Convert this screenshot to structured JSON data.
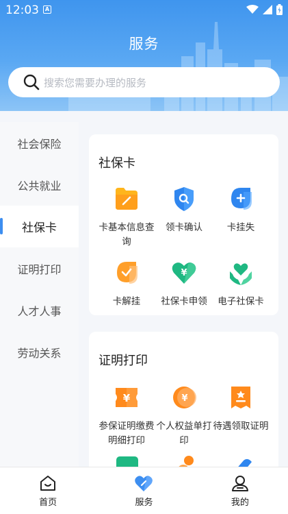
{
  "status": {
    "time": "12:03",
    "indicator": "A"
  },
  "header": {
    "title": "服务",
    "search_placeholder": "搜索您需要办理的服务"
  },
  "sidebar": {
    "items": [
      {
        "label": "社会保险",
        "active": false
      },
      {
        "label": "公共就业",
        "active": false
      },
      {
        "label": "社保卡",
        "active": true
      },
      {
        "label": "证明打印",
        "active": false
      },
      {
        "label": "人才人事",
        "active": false
      },
      {
        "label": "劳动关系",
        "active": false
      }
    ]
  },
  "sections": [
    {
      "title": "社保卡",
      "services": [
        {
          "label": "卡基本信息查询",
          "icon": "card-info-icon"
        },
        {
          "label": "领卡确认",
          "icon": "shield-search-icon"
        },
        {
          "label": "卡挂失",
          "icon": "plus-drop-icon"
        },
        {
          "label": "卡解挂",
          "icon": "check-drop-icon"
        },
        {
          "label": "社保卡申领",
          "icon": "heart-yuan-icon"
        },
        {
          "label": "电子社保卡",
          "icon": "heart-hands-icon"
        }
      ]
    },
    {
      "title": "证明打印",
      "services": [
        {
          "label": "参保证明缴费明细打印",
          "icon": "yuan-ticket-icon"
        },
        {
          "label": "个人权益单打印",
          "icon": "yuan-circle-icon"
        },
        {
          "label": "待遇领取证明",
          "icon": "award-ticket-icon"
        }
      ]
    }
  ],
  "tabbar": {
    "items": [
      {
        "label": "首页",
        "icon": "home-icon"
      },
      {
        "label": "服务",
        "icon": "heart-service-icon",
        "active": true
      },
      {
        "label": "我的",
        "icon": "user-icon"
      }
    ]
  },
  "colors": {
    "accent": "#3d8ef0",
    "header": "#4a9cf0",
    "orange": "#ff8a1c",
    "green": "#24c08a"
  }
}
